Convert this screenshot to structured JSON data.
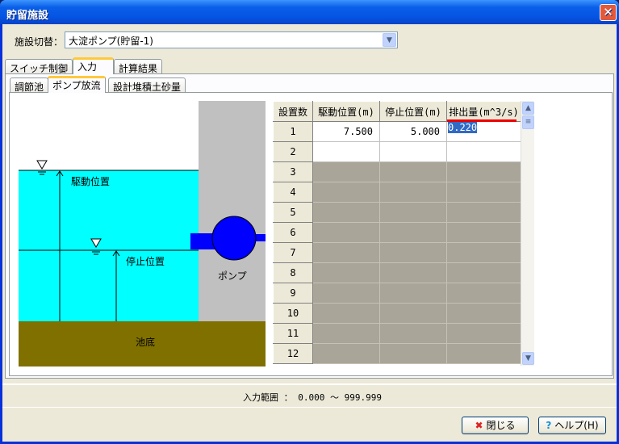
{
  "window": {
    "title": "貯留施設",
    "close_label": "✕"
  },
  "facility": {
    "label": "施設切替：",
    "value": "大淀ポンプ(貯留-1)"
  },
  "tabs": [
    "スイッチ制御",
    "入力",
    "計算結果"
  ],
  "subtabs": [
    "調節池",
    "ポンプ放流",
    "設計堆積土砂量"
  ],
  "diagram": {
    "drive_label": "駆動位置",
    "stop_label": "停止位置",
    "pump_label": "ポンプ",
    "bottom_label": "池底"
  },
  "grid": {
    "headers": [
      "設置数",
      "駆動位置(m)",
      "停止位置(m)",
      "排出量(m^3/s)"
    ],
    "rows": [
      {
        "n": "1",
        "drive": "7.500",
        "stop": "5.000",
        "flow": "0.220"
      },
      {
        "n": "2",
        "drive": "",
        "stop": "",
        "flow": ""
      },
      {
        "n": "3"
      },
      {
        "n": "4"
      },
      {
        "n": "5"
      },
      {
        "n": "6"
      },
      {
        "n": "7"
      },
      {
        "n": "8"
      },
      {
        "n": "9"
      },
      {
        "n": "10"
      },
      {
        "n": "11"
      },
      {
        "n": "12"
      }
    ]
  },
  "status": {
    "range": "入力範囲 ： 0.000 ～ 999.999"
  },
  "buttons": {
    "close": "閉じる",
    "help": "ヘルプ(H)"
  }
}
